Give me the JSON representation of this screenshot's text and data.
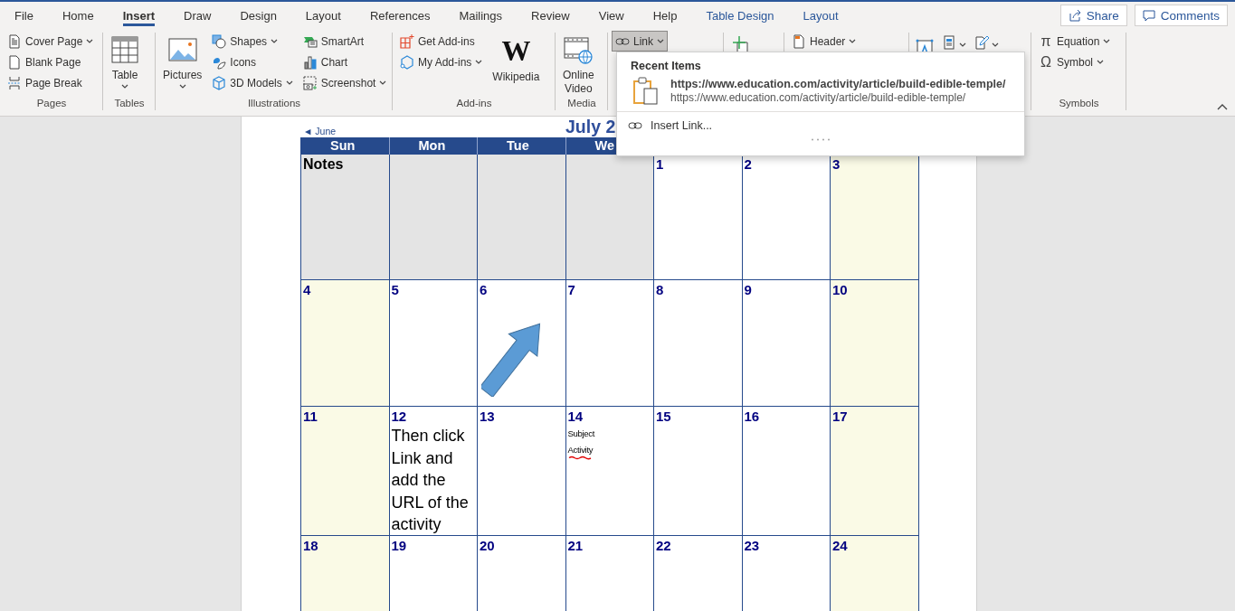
{
  "tabs": [
    {
      "label": "File",
      "kind": "standard",
      "selected": false
    },
    {
      "label": "Home",
      "kind": "standard",
      "selected": false
    },
    {
      "label": "Insert",
      "kind": "standard",
      "selected": true
    },
    {
      "label": "Draw",
      "kind": "standard",
      "selected": false
    },
    {
      "label": "Design",
      "kind": "standard",
      "selected": false
    },
    {
      "label": "Layout",
      "kind": "standard",
      "selected": false
    },
    {
      "label": "References",
      "kind": "standard",
      "selected": false
    },
    {
      "label": "Mailings",
      "kind": "standard",
      "selected": false
    },
    {
      "label": "Review",
      "kind": "standard",
      "selected": false
    },
    {
      "label": "View",
      "kind": "standard",
      "selected": false
    },
    {
      "label": "Help",
      "kind": "standard",
      "selected": false
    },
    {
      "label": "Table Design",
      "kind": "contextual",
      "selected": false
    },
    {
      "label": "Layout",
      "kind": "contextual",
      "selected": false
    }
  ],
  "share_button": "Share",
  "comments_button": "Comments",
  "ribbon_groups": [
    {
      "label": "Pages",
      "columns": [
        [
          {
            "kind": "small",
            "label": "Cover Page",
            "dropdown": true,
            "pressed": false
          },
          {
            "kind": "small",
            "label": "Blank Page",
            "dropdown": false,
            "pressed": false
          },
          {
            "kind": "small",
            "label": "Page Break",
            "dropdown": false,
            "pressed": false
          }
        ]
      ]
    },
    {
      "label": "Tables",
      "columns": [
        [
          {
            "kind": "large",
            "label": "Table",
            "dropdown": true,
            "pressed": false
          }
        ]
      ]
    },
    {
      "label": "Illustrations",
      "columns": [
        [
          {
            "kind": "large",
            "label": "Pictures",
            "dropdown": true,
            "pressed": false
          }
        ],
        [
          {
            "kind": "small",
            "label": "Shapes",
            "dropdown": true,
            "pressed": false
          },
          {
            "kind": "small",
            "label": "Icons",
            "dropdown": false,
            "pressed": false
          },
          {
            "kind": "small",
            "label": "3D Models",
            "dropdown": true,
            "pressed": false
          }
        ],
        [
          {
            "kind": "small",
            "label": "SmartArt",
            "dropdown": false,
            "pressed": false
          },
          {
            "kind": "small",
            "label": "Chart",
            "dropdown": false,
            "pressed": false
          },
          {
            "kind": "small",
            "label": "Screenshot",
            "dropdown": true,
            "pressed": false
          }
        ]
      ]
    },
    {
      "label": "Add-ins",
      "columns": [
        [
          {
            "kind": "small",
            "label": "Get Add-ins",
            "dropdown": false,
            "pressed": false
          },
          {
            "kind": "small",
            "label": "My Add-ins",
            "dropdown": true,
            "pressed": false
          }
        ],
        [
          {
            "kind": "large",
            "label": "Wikipedia",
            "glyph": "W",
            "dropdown": false,
            "pressed": false
          }
        ]
      ]
    },
    {
      "label": "Media",
      "columns": [
        [
          {
            "kind": "large",
            "label": "Online Video",
            "dropdown": false,
            "pressed": false
          }
        ]
      ]
    },
    {
      "columns": [
        [
          {
            "kind": "small",
            "label": "Link",
            "dropdown": true,
            "pressed": true
          }
        ]
      ]
    },
    {
      "columns": [
        [
          {
            "kind": "icon",
            "dropdown": false,
            "pressed": false
          }
        ]
      ]
    },
    {
      "columns": [
        [
          {
            "kind": "small",
            "label": "Header",
            "dropdown": true,
            "pressed": false
          }
        ]
      ]
    },
    {
      "columns": [
        [
          {
            "kind": "icon",
            "dropdown": false,
            "pressed": false
          }
        ],
        [
          {
            "kind": "icon",
            "dropdown": true,
            "pressed": false
          }
        ],
        [
          {
            "kind": "icon",
            "dropdown": true,
            "pressed": false
          }
        ]
      ]
    },
    {
      "label": "Symbols",
      "columns": [
        [
          {
            "kind": "small",
            "label": "Equation",
            "glyph": "π",
            "dropdown": true,
            "pressed": false
          },
          {
            "kind": "small",
            "label": "Symbol",
            "glyph": "Ω",
            "dropdown": true,
            "pressed": false
          }
        ]
      ]
    }
  ],
  "link_menu": {
    "heading": "Recent Items",
    "recent": [
      {
        "title": "https://www.education.com/activity/article/build-edible-temple/",
        "url": "https://www.education.com/activity/article/build-edible-temple/"
      }
    ],
    "action": "Insert Link..."
  },
  "calendar": {
    "prev_month": "◄ June",
    "title": "July 2",
    "weekdays": [
      "Sun",
      "Mon",
      "Tue",
      "We"
    ],
    "weeks": [
      {
        "cells": [
          {
            "kind": "notes",
            "label": "Notes"
          },
          {
            "kind": "blank"
          },
          {
            "kind": "blank"
          },
          {
            "kind": "blank"
          },
          {
            "kind": "weekday",
            "day": "1"
          },
          {
            "kind": "weekday",
            "day": "2"
          },
          {
            "kind": "weekend",
            "day": "3"
          }
        ]
      },
      {
        "cells": [
          {
            "kind": "weekend",
            "day": "4"
          },
          {
            "kind": "weekday",
            "day": "5"
          },
          {
            "kind": "weekday",
            "day": "6"
          },
          {
            "kind": "weekday",
            "day": "7"
          },
          {
            "kind": "weekday",
            "day": "8"
          },
          {
            "kind": "weekday",
            "day": "9"
          },
          {
            "kind": "weekend",
            "day": "10"
          }
        ]
      },
      {
        "cells": [
          {
            "kind": "weekend",
            "day": "11"
          },
          {
            "kind": "weekday",
            "day": "12",
            "notes": [
              {
                "kind": "large",
                "text": "Then click Link and add the URL of the activity",
                "misspelled": false
              }
            ]
          },
          {
            "kind": "weekday",
            "day": "13"
          },
          {
            "kind": "weekday",
            "day": "14",
            "notes": [
              {
                "kind": "small",
                "text": "Subject",
                "misspelled": false
              },
              {
                "kind": "small",
                "text": "Activity",
                "misspelled": true
              }
            ]
          },
          {
            "kind": "weekday",
            "day": "15"
          },
          {
            "kind": "weekday",
            "day": "16"
          },
          {
            "kind": "weekend",
            "day": "17"
          }
        ]
      },
      {
        "cells": [
          {
            "kind": "weekend",
            "day": "18"
          },
          {
            "kind": "weekday",
            "day": "19"
          },
          {
            "kind": "weekday",
            "day": "20"
          },
          {
            "kind": "weekday",
            "day": "21"
          },
          {
            "kind": "weekday",
            "day": "22"
          },
          {
            "kind": "weekday",
            "day": "23"
          },
          {
            "kind": "weekend",
            "day": "24"
          }
        ]
      }
    ]
  }
}
